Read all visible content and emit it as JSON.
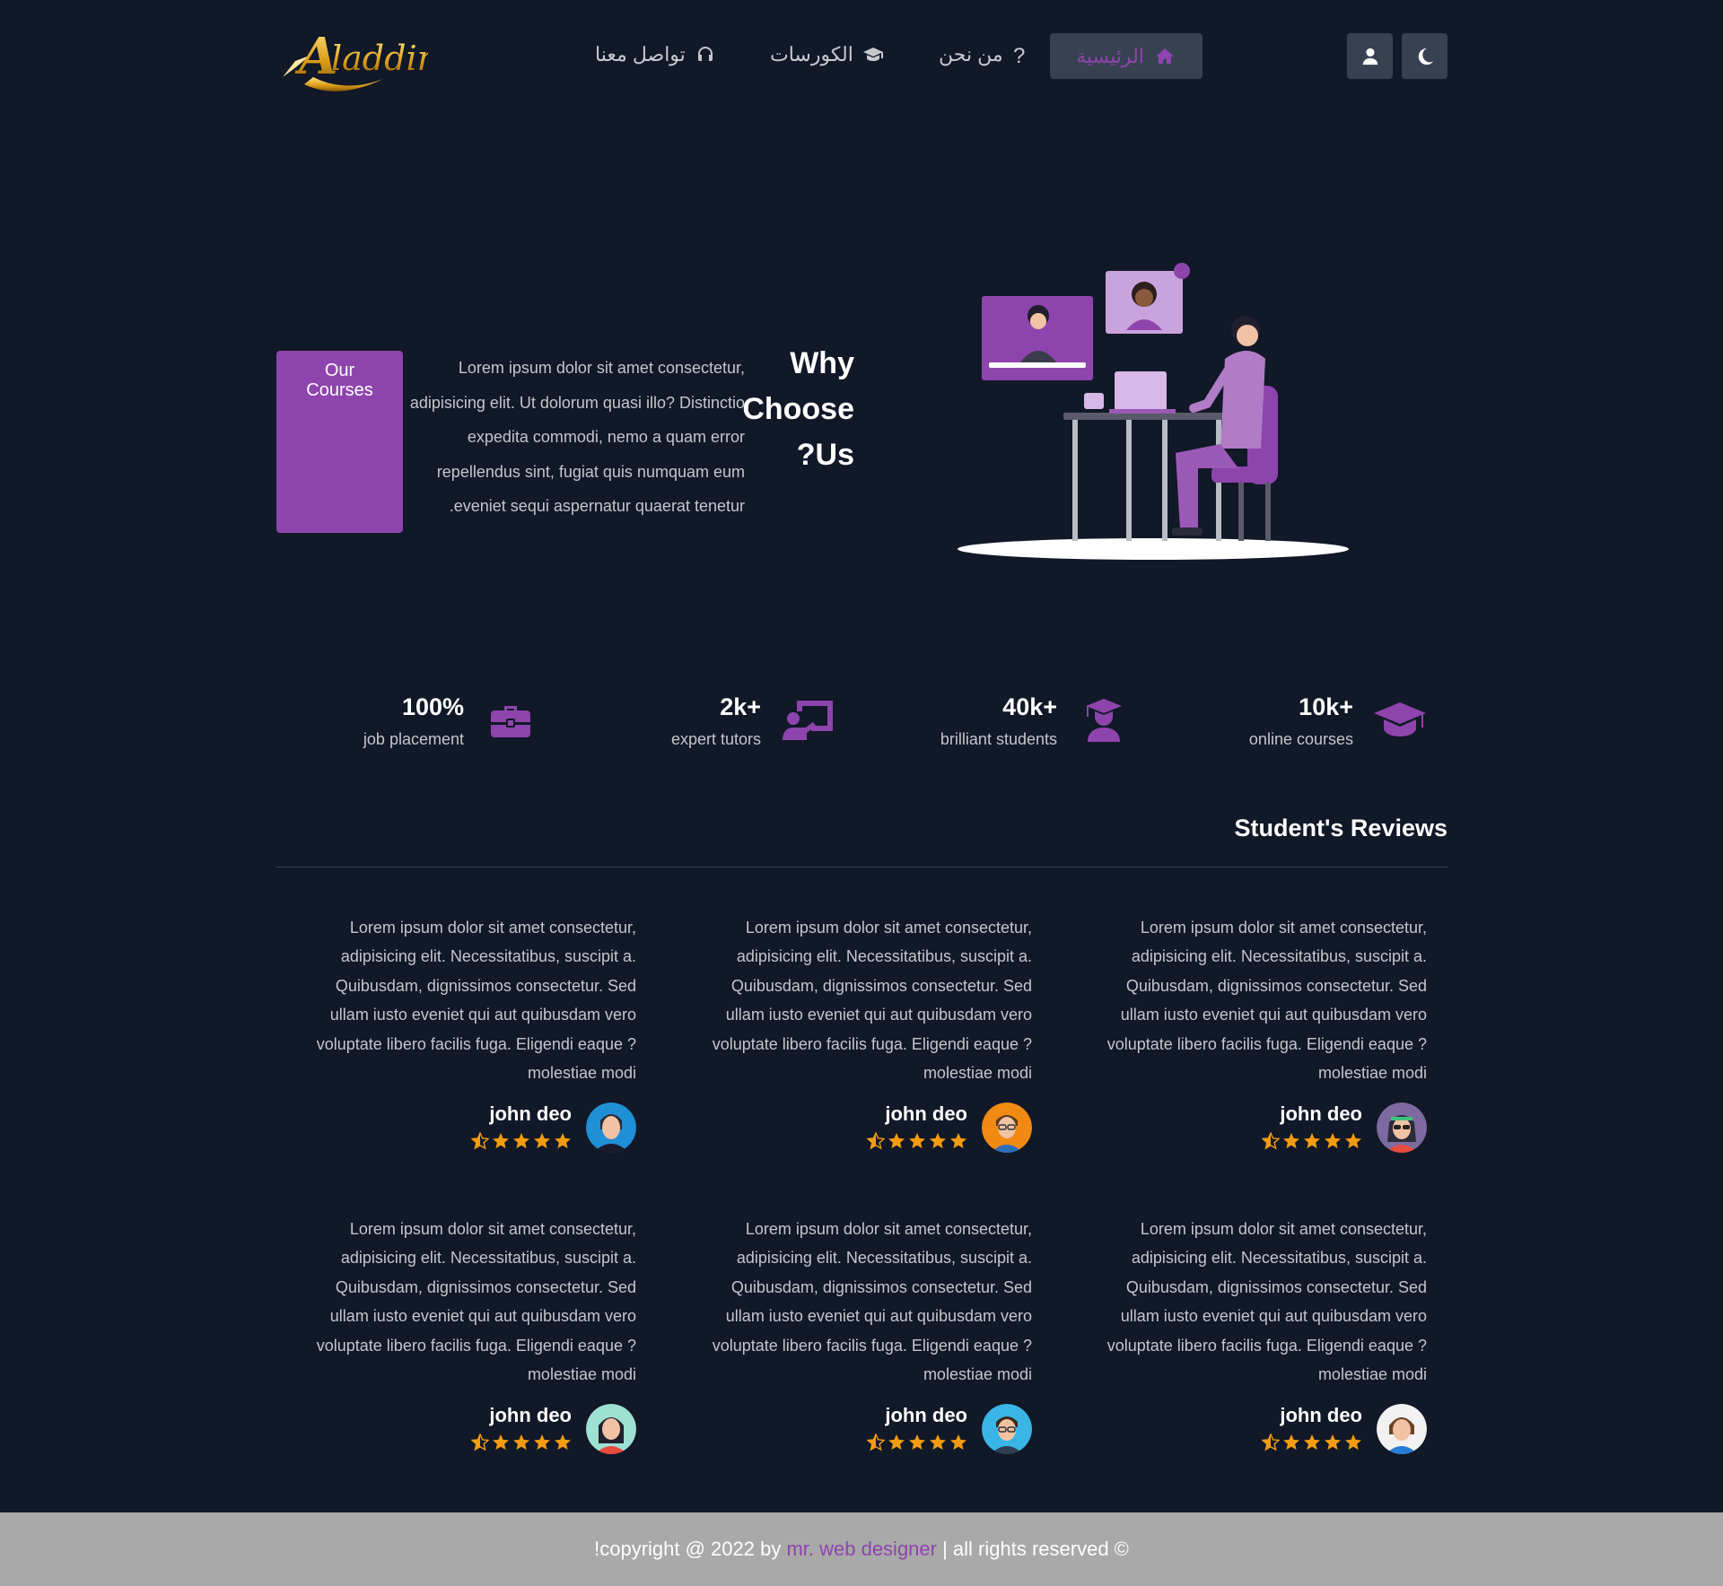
{
  "nav": {
    "logo_text": "Aladdin",
    "links": [
      {
        "label": "تواصل معنا",
        "icon": "headset-icon"
      },
      {
        "label": "الكورسات",
        "icon": "graduation-cap-icon"
      },
      {
        "label": "من نحن",
        "icon": "question-icon"
      }
    ],
    "home": {
      "label": "الرئيسية",
      "icon": "home-icon"
    },
    "user_icon": "user-icon",
    "theme_icon": "moon-icon"
  },
  "why": {
    "courses_box": "Our Courses",
    "title": "Why Choose ?Us",
    "text": "Lorem ipsum dolor sit amet consectetur, adipisicing elit. Ut dolorum quasi illo? Distinctio expedita commodi, nemo a quam error repellendus sint, fugiat quis numquam eum .eveniet sequi aspernatur quaerat tenetur"
  },
  "stats": [
    {
      "value": "100%",
      "label": "job placement",
      "icon": "briefcase-icon"
    },
    {
      "value": "2k+",
      "label": "expert tutors",
      "icon": "tutor-board-icon"
    },
    {
      "value": "40k+",
      "label": "brilliant students",
      "icon": "student-icon"
    },
    {
      "value": "10k+",
      "label": "online courses",
      "icon": "graduation-cap-icon"
    }
  ],
  "reviews": {
    "title": "Student's Reviews",
    "items": [
      {
        "text": "Lorem ipsum dolor sit amet consectetur, adipisicing elit. Necessitatibus, suscipit a. Quibusdam, dignissimos consectetur. Sed ullam iusto eveniet qui aut quibusdam vero voluptate libero facilis fuga. Eligendi eaque ?molestiae modi",
        "name": "john deo",
        "rating": 4.5
      },
      {
        "text": "Lorem ipsum dolor sit amet consectetur, adipisicing elit. Necessitatibus, suscipit a. Quibusdam, dignissimos consectetur. Sed ullam iusto eveniet qui aut quibusdam vero voluptate libero facilis fuga. Eligendi eaque ?molestiae modi",
        "name": "john deo",
        "rating": 4.5
      },
      {
        "text": "Lorem ipsum dolor sit amet consectetur, adipisicing elit. Necessitatibus, suscipit a. Quibusdam, dignissimos consectetur. Sed ullam iusto eveniet qui aut quibusdam vero voluptate libero facilis fuga. Eligendi eaque ?molestiae modi",
        "name": "john deo",
        "rating": 4.5
      },
      {
        "text": "Lorem ipsum dolor sit amet consectetur, adipisicing elit. Necessitatibus, suscipit a. Quibusdam, dignissimos consectetur. Sed ullam iusto eveniet qui aut quibusdam vero voluptate libero facilis fuga. Eligendi eaque ?molestiae modi",
        "name": "john deo",
        "rating": 4.5
      },
      {
        "text": "Lorem ipsum dolor sit amet consectetur, adipisicing elit. Necessitatibus, suscipit a. Quibusdam, dignissimos consectetur. Sed ullam iusto eveniet qui aut quibusdam vero voluptate libero facilis fuga. Eligendi eaque ?molestiae modi",
        "name": "john deo",
        "rating": 4.5
      },
      {
        "text": "Lorem ipsum dolor sit amet consectetur, adipisicing elit. Necessitatibus, suscipit a. Quibusdam, dignissimos consectetur. Sed ullam iusto eveniet qui aut quibusdam vero voluptate libero facilis fuga. Eligendi eaque ?molestiae modi",
        "name": "john deo",
        "rating": 4.5
      }
    ]
  },
  "footer": {
    "before": "!copyright @ 2022 by ",
    "brand": "mr. web designer",
    "after": " | all rights reserved ©"
  },
  "colors": {
    "background": "#111827",
    "accent": "#8e44ad",
    "button_bg": "#374151",
    "star": "#f39c12",
    "footer_bg": "#a9a9a9"
  }
}
